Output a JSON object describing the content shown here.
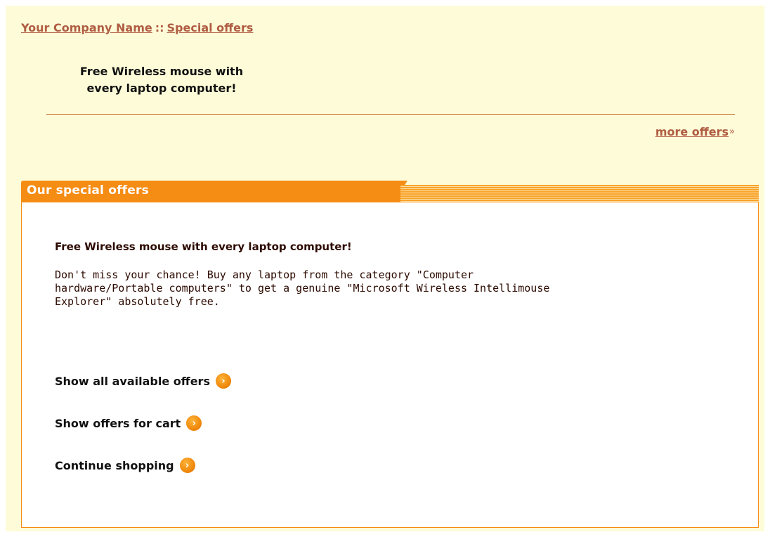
{
  "breadcrumb": {
    "company": "Your Company Name",
    "separator": "::",
    "current": "Special offers"
  },
  "promo": {
    "line1": "Free Wireless mouse with",
    "line2": "every laptop computer!"
  },
  "more_offers": {
    "label": "more offers",
    "arrows": "»"
  },
  "box": {
    "title": "Our special offers",
    "offer_title": "Free Wireless mouse with every laptop computer!",
    "offer_desc_lines": [
      "Don't miss your chance! Buy any laptop from the category \"Computer",
      "hardware/Portable computers\" to get a genuine \"Microsoft Wireless Intellimouse",
      "Explorer\" absolutely free."
    ]
  },
  "actions": [
    {
      "label": "Show all available offers",
      "icon": "chevron-right-icon"
    },
    {
      "label": "Show offers for cart",
      "icon": "chevron-right-icon"
    },
    {
      "label": "Continue shopping",
      "icon": "chevron-right-icon"
    }
  ],
  "colors": {
    "page_bg": "#fefcd8",
    "accent": "#f58c14",
    "link": "#b05d43"
  }
}
